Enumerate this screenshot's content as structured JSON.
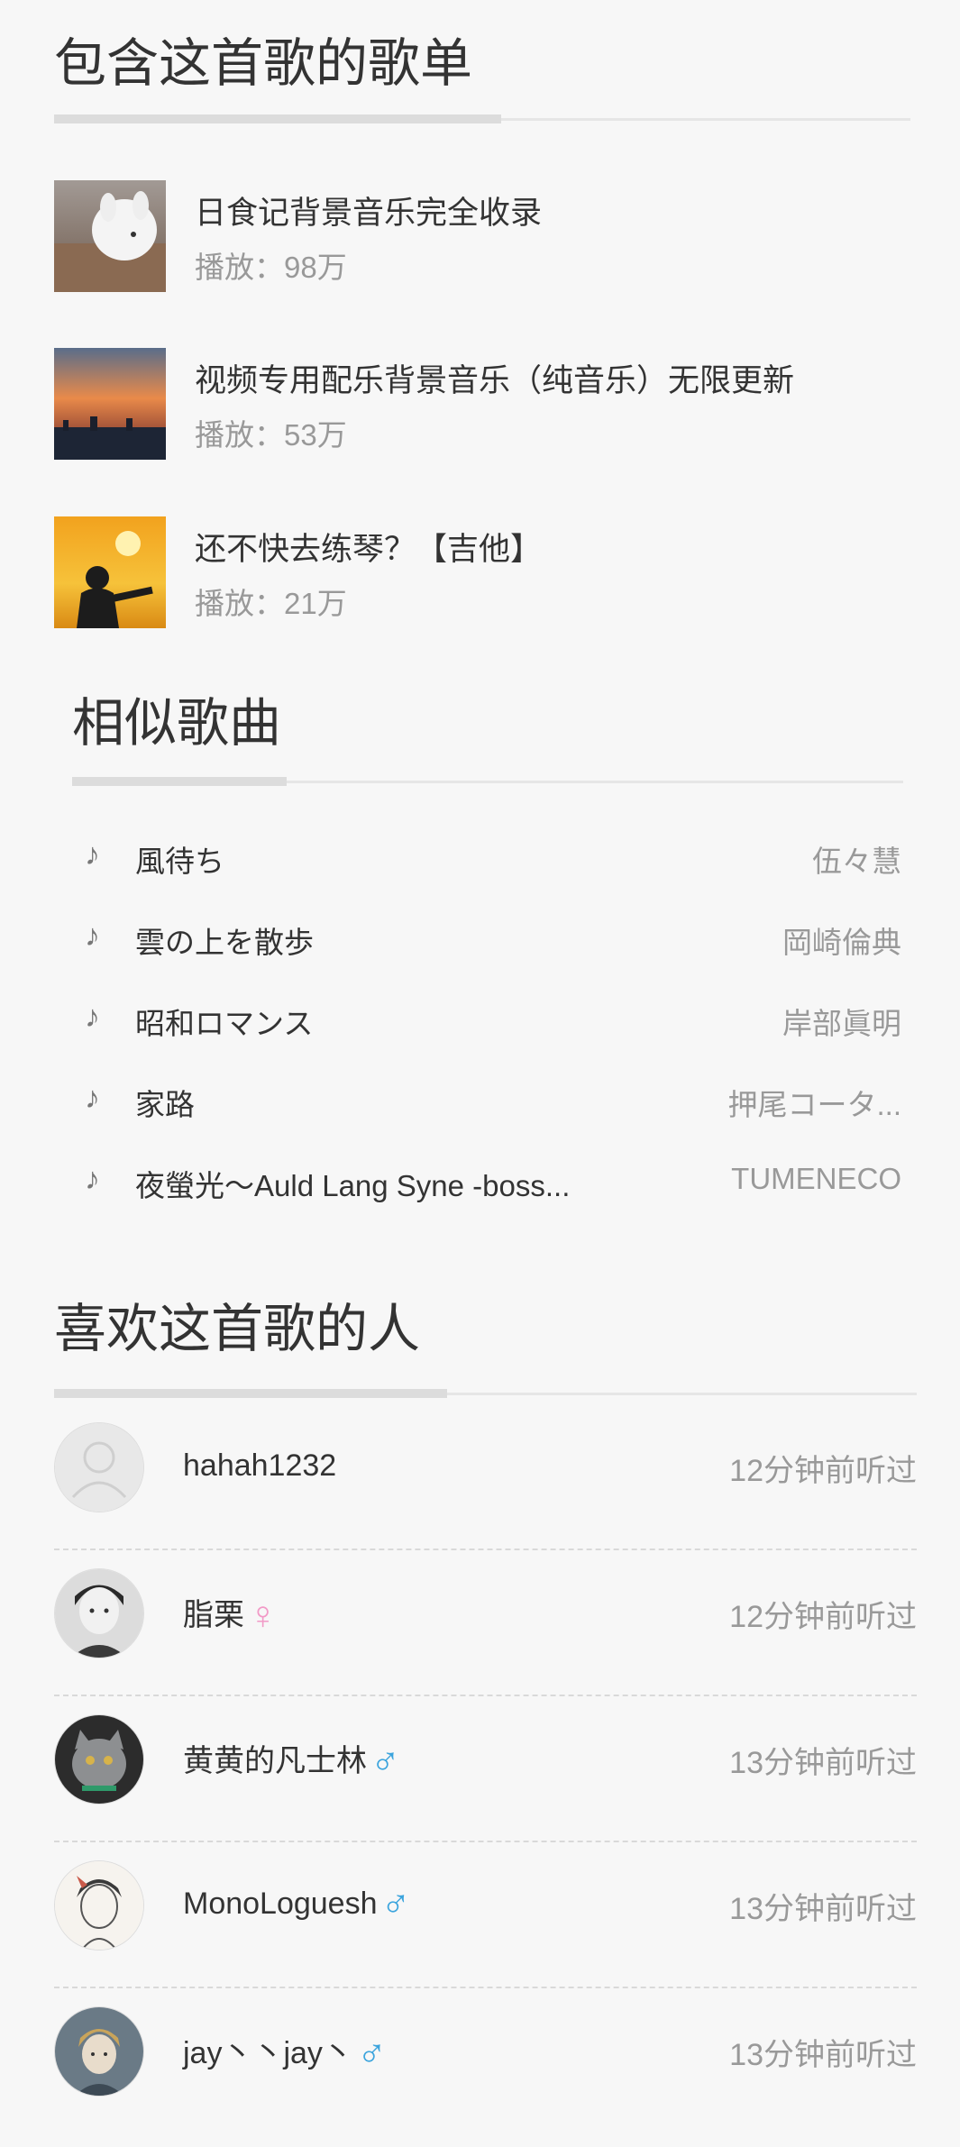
{
  "playlists_section": {
    "title": "包含这首歌的歌单",
    "items": [
      {
        "name": "日食记背景音乐完全收录",
        "plays": "播放：98万",
        "cover": "cat-in-box-photo"
      },
      {
        "name": "视频专用配乐背景音乐（纯音乐）无限更新",
        "plays": "播放：53万",
        "cover": "sunset-city-photo"
      },
      {
        "name": "还不快去练琴？【吉他】",
        "plays": "播放：21万",
        "cover": "guitarist-sunset-photo"
      }
    ]
  },
  "similar_songs_section": {
    "title": "相似歌曲",
    "icon": "music-note-icon",
    "songs": [
      {
        "name": "風待ち",
        "artist": "伍々慧"
      },
      {
        "name": "雲の上を散歩",
        "artist": "岡崎倫典"
      },
      {
        "name": "昭和ロマンス",
        "artist": "岸部眞明"
      },
      {
        "name": "家路",
        "artist": "押尾コータ..."
      },
      {
        "name": "夜螢光～Auld Lang Syne -boss...",
        "artist": "TUMENECO"
      }
    ]
  },
  "likers_section": {
    "title": "喜欢这首歌的人",
    "users": [
      {
        "name": "hahah1232",
        "gender": "",
        "time": "12分钟前听过",
        "avatar": "default-avatar"
      },
      {
        "name": "脂栗",
        "gender": "♀",
        "time": "12分钟前听过",
        "avatar": "girl-bw-photo"
      },
      {
        "name": "黄黄的凡士林",
        "gender": "♂",
        "time": "13分钟前听过",
        "avatar": "gray-cat-photo"
      },
      {
        "name": "MonoLoguesh",
        "gender": "♂",
        "time": "13分钟前听过",
        "avatar": "anime-sketch"
      },
      {
        "name": "jay丶丶jay丶",
        "gender": "♂",
        "time": "13分钟前听过",
        "avatar": "anime-boy-art"
      }
    ]
  },
  "colors": {
    "background": "#f7f7f7",
    "text_primary": "#333333",
    "text_secondary": "#999999",
    "female": "#f29ac7",
    "male": "#3ba4dd"
  }
}
